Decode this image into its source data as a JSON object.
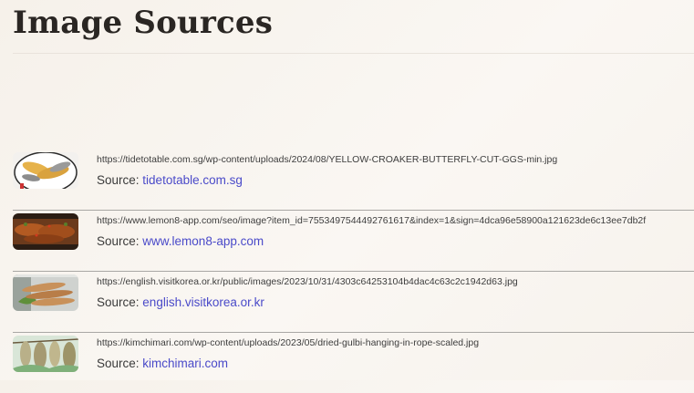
{
  "page": {
    "title": "Image Sources"
  },
  "sources": [
    {
      "url": "https://tidetotable.com.sg/wp-content/uploads/2024/08/YELLOW-CROAKER-BUTTERFLY-CUT-GGS-min.jpg",
      "label": "Source:",
      "domain": "tidetotable.com.sg"
    },
    {
      "url": "https://www.lemon8-app.com/seo/image?item_id=7553497544492761617&index=1&sign=4dca96e58900a121623de6c13ee7db2f",
      "label": "Source:",
      "domain": "www.lemon8-app.com"
    },
    {
      "url": "https://english.visitkorea.or.kr/public/images/2023/10/31/4303c64253104b4dac4c63c2c1942d63.jpg",
      "label": "Source:",
      "domain": "english.visitkorea.or.kr"
    },
    {
      "url": "https://kimchimari.com/wp-content/uploads/2023/05/dried-gulbi-hanging-in-rope-scaled.jpg",
      "label": "Source:",
      "domain": "kimchimari.com"
    }
  ],
  "colors": {
    "link": "#4a4ac9",
    "divider": "#a9a7a4",
    "title": "#2a2623"
  }
}
